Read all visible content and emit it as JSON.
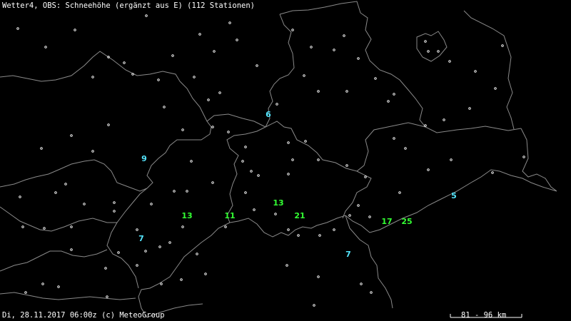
{
  "header": {
    "title": "Wetter4, OBS: Schneehöhe (ergänzt aus E) (112 Stationen)"
  },
  "footer": {
    "datetime": "Di, 28.11.2017 06:00z (c) MeteoGroup"
  },
  "scale": {
    "label": "81 - 96 km"
  },
  "colors": {
    "background": "#000000",
    "border": "#8a8a8a",
    "station": "#ffffff",
    "value_low": "#55e6ff",
    "value_mid": "#33ff33"
  },
  "values": [
    {
      "value": "6",
      "class": "low"
    },
    {
      "value": "9",
      "class": "low"
    },
    {
      "value": "13",
      "class": "mid"
    },
    {
      "value": "11",
      "class": "mid"
    },
    {
      "value": "13",
      "class": "mid"
    },
    {
      "value": "21",
      "class": "mid"
    },
    {
      "value": "7",
      "class": "low"
    },
    {
      "value": "7",
      "class": "low"
    },
    {
      "value": "17",
      "class": "mid"
    },
    {
      "value": "25",
      "class": "mid"
    },
    {
      "value": "5",
      "class": "low"
    }
  ]
}
